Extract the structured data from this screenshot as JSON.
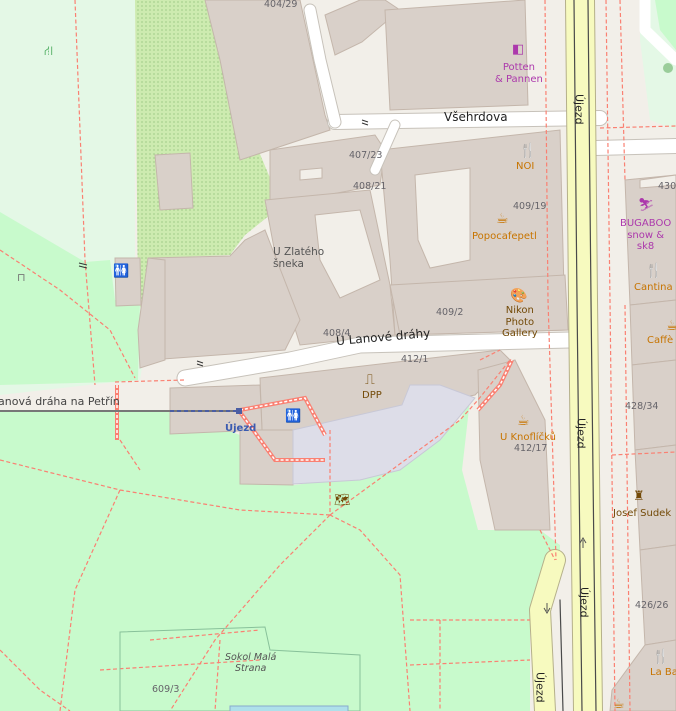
{
  "streets": {
    "vsehrdova": "Všehrdova",
    "u_lanove_drahy": "U Lanové dráhy",
    "ujezd_upper": "Újezd",
    "ujezd_middle": "Újezd",
    "ujezd_lower": "Újezd",
    "ujezd_lane": "Újezd",
    "funicular": "anová dráha na Petřín"
  },
  "places": {
    "u_zlateho_sneka": "U Zlatého\nšneka",
    "sokol": "Sokol Malá\nStrana"
  },
  "stops": {
    "ujezd_funicular": "Újezd"
  },
  "pois": {
    "potten": "Potten\n& Pannen",
    "noi": "NOI",
    "popocafepetl": "Popocafepetl",
    "nikon": "Nikon\nPhoto\nGallery",
    "bugaboo": "BUGABOO\nsnow &\nsk8",
    "cantina": "Cantina",
    "caffe": "Caffè V",
    "dpp": "DPP",
    "u_knoflicku": "U Knoflíčků",
    "josef_sudek": "Josef Sudek",
    "la_bastila": "La Bastil"
  },
  "housenumbers": {
    "h404_29": "404/29",
    "h407_23": "407/23",
    "h408_21": "408/21",
    "h409_19": "409/19",
    "h409_2": "409/2",
    "h408_4": "408/4",
    "h412_1": "412/1",
    "h412_17": "412/17",
    "h428_34": "428/34",
    "h426_26": "426/26",
    "h609_3": "609/3",
    "h430": "430"
  },
  "icons": {
    "toilets": "toilets-icon",
    "cafe": "cafe-icon",
    "restaurant": "restaurant-icon",
    "art_gallery": "art-gallery-icon",
    "sports_shop": "sports-shop-icon",
    "ticket_office": "ticket-office-icon",
    "bag_shop": "bag-shop-icon",
    "map_board": "map-board-icon",
    "monument": "monument-icon",
    "playground": "playground-icon",
    "bench": "bench-icon"
  },
  "colors": {
    "background": "#f2efe9",
    "park": "#c8facc",
    "park_light": "#e4f8e6",
    "grass_dotted": "#cdebb0",
    "building": "#d9d0c9",
    "building_outline": "#c4b6ab",
    "secondary_road": "#f7fabf",
    "footway": "#fa8072",
    "parking": "#dddde8",
    "funicular": "#777777",
    "poi_food": "#c77400",
    "poi_shop": "#ac39ac",
    "poi_culture": "#734a08"
  }
}
